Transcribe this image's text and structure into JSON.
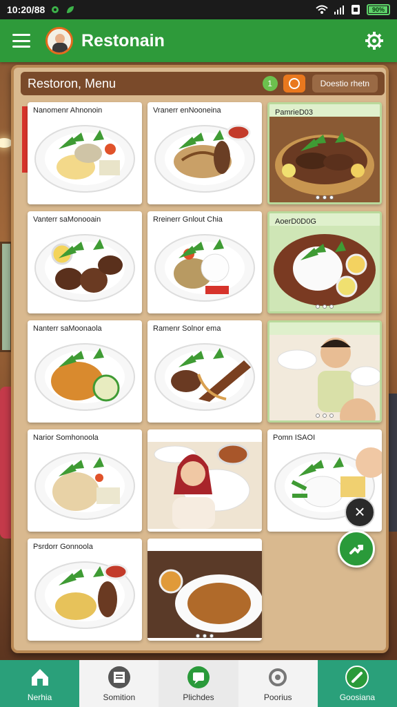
{
  "status_bar": {
    "time": "10:20/88",
    "battery": "90%"
  },
  "app_bar": {
    "title": "Restonain"
  },
  "menu": {
    "title": "Restoron, Menu",
    "badge": "1",
    "pill_label": "Doestio rhetn"
  },
  "cards": [
    {
      "title": "Nanomenr Ahnonoin",
      "style": "white",
      "dish": "plate-rice"
    },
    {
      "title": "Vranerr enNooneina",
      "style": "white",
      "dish": "plate-noodle"
    },
    {
      "title": "PamrieD03",
      "style": "green",
      "dish": "basket-meat"
    },
    {
      "title": "Vanterr saMonooain",
      "style": "white",
      "dish": "plate-meat"
    },
    {
      "title": "Rreinerr Gnlout Chia",
      "style": "white",
      "dish": "plate-salad"
    },
    {
      "title": "AoerD0D0G",
      "style": "green",
      "dish": "bowl-rice"
    },
    {
      "title": "Nanterr saMoonaola",
      "style": "white",
      "dish": "plate-curry"
    },
    {
      "title": "Ramenr Solnor ema",
      "style": "white",
      "dish": "plate-chicken"
    },
    {
      "title": "",
      "style": "green",
      "dish": "people"
    },
    {
      "title": "Narior Somhonoola",
      "style": "white",
      "dish": "plate-rice2"
    },
    {
      "title": "",
      "style": "white",
      "dish": "woman"
    },
    {
      "title": "Pomn ISAOI",
      "style": "white",
      "dish": "plate-satay"
    },
    {
      "title": "Psrdorr Gonnoola",
      "style": "white",
      "dish": "plate-mix"
    },
    {
      "title": "",
      "style": "white",
      "dish": "fried"
    }
  ],
  "bottom_nav": [
    {
      "label": "Nerhia",
      "icon": "home-icon"
    },
    {
      "label": "Somition",
      "icon": "menu-book-icon"
    },
    {
      "label": "Plichdes",
      "icon": "chat-icon"
    },
    {
      "label": "Poorius",
      "icon": "settings-icon"
    },
    {
      "label": "Goosiana",
      "icon": "phone-icon"
    }
  ],
  "colors": {
    "primary": "#2e9a3a",
    "accent": "#e9781e",
    "panel": "#d9b98f"
  }
}
